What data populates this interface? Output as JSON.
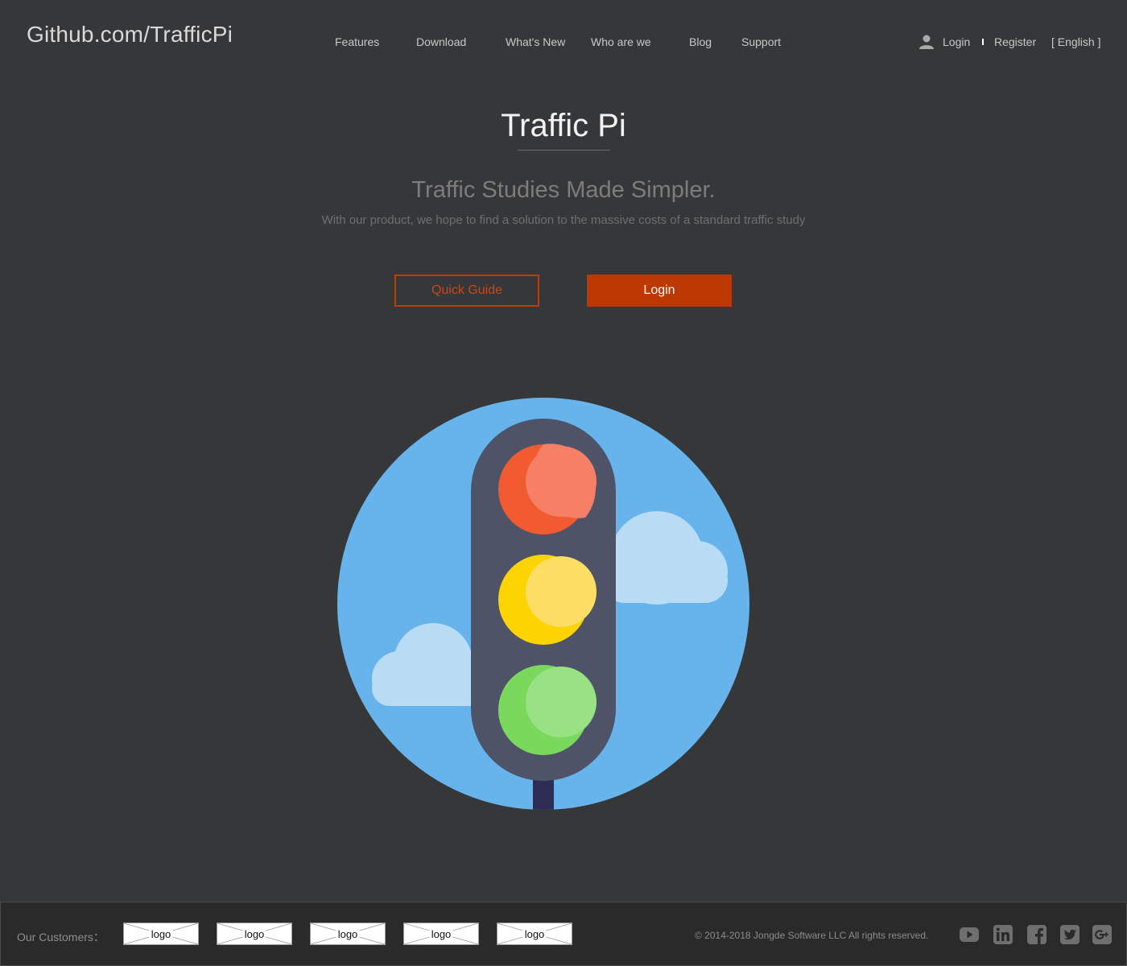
{
  "header": {
    "brand": "Github.com/TrafficPi",
    "nav": {
      "features": "Features",
      "download": "Download",
      "whats_new": "What's New",
      "who_are_we": "Who are we",
      "blog": "Blog",
      "support": "Support"
    },
    "account": {
      "login": "Login",
      "register": "Register",
      "language": "[ English ]"
    }
  },
  "hero": {
    "title": "Traffic Pi",
    "tagline": "Traffic Studies Made Simpler.",
    "description": "With our product, we hope to find a solution to the massive costs of a standard traffic study",
    "quick_guide_label": "Quick Guide",
    "login_label": "Login",
    "illustration": "traffic-light-icon"
  },
  "footer": {
    "customers_label": "Our Customers：",
    "logos": [
      "logo",
      "logo",
      "logo",
      "logo",
      "logo"
    ],
    "copyright": "© 2014-2018 Jongde Software LLC All rights reserved.",
    "social": [
      "youtube-icon",
      "linkedin-icon",
      "facebook-icon",
      "twitter-icon",
      "google-plus-icon"
    ]
  },
  "colors": {
    "background": "#363739",
    "footer_bg": "#2a2a2b",
    "accent": "#bc3800",
    "sky": "#67b4ec",
    "pole": "#4e5367",
    "red_light": "#f25a30",
    "yellow_light": "#fed400",
    "green_light": "#7ad95c"
  }
}
